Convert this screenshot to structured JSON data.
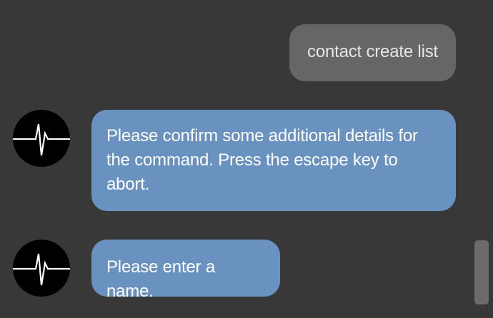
{
  "messages": [
    {
      "role": "user",
      "text": "contact create list"
    },
    {
      "role": "bot",
      "avatar_icon": "heartbeat-pulse-icon",
      "text": "Please confirm some additional details for the command. Press the escape key to abort."
    },
    {
      "role": "bot",
      "avatar_icon": "heartbeat-pulse-icon",
      "text": "Please enter a name."
    }
  ],
  "colors": {
    "background": "#383838",
    "user_bubble": "#666666",
    "bot_bubble": "#6a92c0",
    "avatar_bg": "#000000",
    "scrollbar_thumb": "#6b6b6b"
  }
}
